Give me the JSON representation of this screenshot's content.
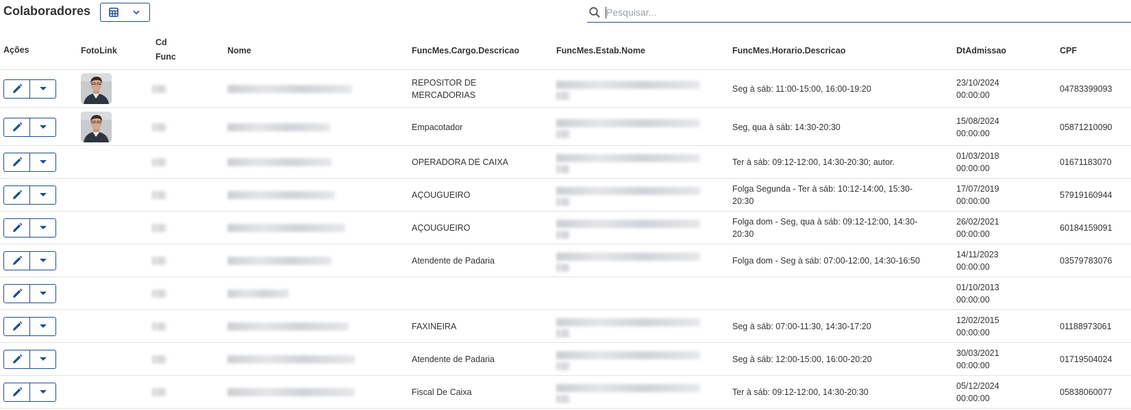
{
  "header": {
    "title": "Colaboradores",
    "grid_button_icon": "table-grid-icon",
    "search_placeholder": "Pesquisar..."
  },
  "columns": {
    "acoes": "Ações",
    "foto": "FotoLink",
    "cd_line1": "Cd",
    "cd_line2": "Func",
    "nome": "Nome",
    "cargo": "FuncMes.Cargo.Descricao",
    "estab": "FuncMes.Estab.Nome",
    "horario": "FuncMes.Horario.Descricao",
    "admissao": "DtAdmissao",
    "cpf": "CPF"
  },
  "rows": [
    {
      "cargo": "REPOSITOR DE MERCADORIAS",
      "horario": "Seg à sáb: 11:00-15:00, 16:00-19:20",
      "adm_date": "23/10/2024",
      "adm_time": "00:00:00",
      "cpf": "04783399093",
      "has_photo": true,
      "has_estab": true
    },
    {
      "cargo": "Empacotador",
      "horario": "Seg, qua à sáb: 14:30-20:30",
      "adm_date": "15/08/2024",
      "adm_time": "00:00:00",
      "cpf": "05871210090",
      "has_photo": true,
      "has_estab": true
    },
    {
      "cargo": "OPERADORA DE CAIXA",
      "horario": "Ter à sáb: 09:12-12:00, 14:30-20:30; autor.",
      "adm_date": "01/03/2018",
      "adm_time": "00:00:00",
      "cpf": "01671183070",
      "has_photo": false,
      "has_estab": true
    },
    {
      "cargo": "AÇOUGUEIRO",
      "horario": "Folga Segunda - Ter à sáb: 10:12-14:00, 15:30-20:30",
      "adm_date": "17/07/2019",
      "adm_time": "00:00:00",
      "cpf": "57919160944",
      "has_photo": false,
      "has_estab": true
    },
    {
      "cargo": "AÇOUGUEIRO",
      "horario": "Folga dom - Seg, qua à sáb: 09:12-12:00, 14:30-20:30",
      "adm_date": "26/02/2021",
      "adm_time": "00:00:00",
      "cpf": "60184159091",
      "has_photo": false,
      "has_estab": true
    },
    {
      "cargo": "Atendente de Padaria",
      "horario": "Folga dom - Seg à sáb: 07:00-12:00, 14:30-16:50",
      "adm_date": "14/11/2023",
      "adm_time": "00:00:00",
      "cpf": "03579783076",
      "has_photo": false,
      "has_estab": true
    },
    {
      "cargo": "",
      "horario": "",
      "adm_date": "01/10/2013",
      "adm_time": "00:00:00",
      "cpf": "",
      "has_photo": false,
      "has_estab": false
    },
    {
      "cargo": "FAXINEIRA",
      "horario": "Seg à sáb: 07:00-11:30, 14:30-17:20",
      "adm_date": "12/02/2015",
      "adm_time": "00:00:00",
      "cpf": "01188973061",
      "has_photo": false,
      "has_estab": true
    },
    {
      "cargo": "Atendente de Padaria",
      "horario": "Seg à sáb: 12:00-15:00, 16:00-20:20",
      "adm_date": "30/03/2021",
      "adm_time": "00:00:00",
      "cpf": "01719504024",
      "has_photo": false,
      "has_estab": true
    },
    {
      "cargo": "Fiscal De Caixa",
      "horario": "Ter à sáb: 09:12-12:00, 14:30-20:30",
      "adm_date": "05/12/2024",
      "adm_time": "00:00:00",
      "cpf": "05838060077",
      "has_photo": false,
      "has_estab": true
    }
  ]
}
